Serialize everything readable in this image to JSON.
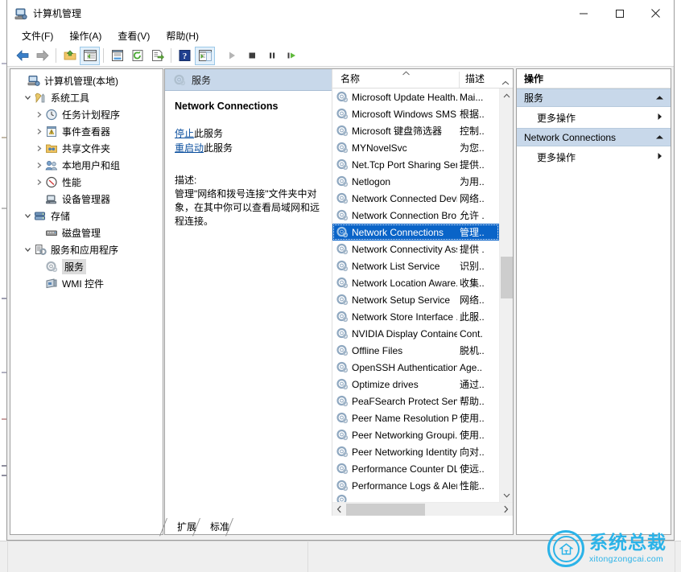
{
  "window": {
    "title": "计算机管理",
    "title_icon": "computer-management-icon",
    "buttons": {
      "minimize": "—",
      "maximize": "▢",
      "close": "✕"
    }
  },
  "menubar": {
    "items": [
      {
        "label": "文件(F)",
        "name": "menu-file"
      },
      {
        "label": "操作(A)",
        "name": "menu-action"
      },
      {
        "label": "查看(V)",
        "name": "menu-view"
      },
      {
        "label": "帮助(H)",
        "name": "menu-help"
      }
    ]
  },
  "toolbar": {
    "buttons": [
      {
        "name": "back-icon",
        "title": "后退"
      },
      {
        "name": "forward-icon",
        "title": "前进"
      },
      {
        "name": "up-folder-icon",
        "title": "上移一级"
      },
      {
        "name": "show-hide-tree-icon",
        "title": "显示/隐藏控制台树"
      },
      {
        "name": "properties-icon",
        "title": "属性"
      },
      {
        "name": "refresh-icon",
        "title": "刷新"
      },
      {
        "name": "export-list-icon",
        "title": "导出列表"
      },
      {
        "name": "help-icon",
        "title": "帮助"
      },
      {
        "name": "show-action-pane-icon",
        "title": "显示/隐藏操作窗格"
      },
      {
        "name": "start-service-icon",
        "title": "启动服务"
      },
      {
        "name": "stop-service-icon",
        "title": "停止服务"
      },
      {
        "name": "pause-service-icon",
        "title": "暂停服务"
      },
      {
        "name": "restart-service-icon",
        "title": "重启服务"
      }
    ]
  },
  "tree": {
    "nodes": [
      {
        "label": "计算机管理(本地)",
        "depth": 0,
        "twisty": "",
        "icon": "computer-icon",
        "selected": false
      },
      {
        "label": "系统工具",
        "depth": 1,
        "twisty": "v",
        "icon": "tools-icon",
        "selected": false
      },
      {
        "label": "任务计划程序",
        "depth": 2,
        "twisty": ">",
        "icon": "clock-icon",
        "selected": false
      },
      {
        "label": "事件查看器",
        "depth": 2,
        "twisty": ">",
        "icon": "event-viewer-icon",
        "selected": false
      },
      {
        "label": "共享文件夹",
        "depth": 2,
        "twisty": ">",
        "icon": "shared-folder-icon",
        "selected": false
      },
      {
        "label": "本地用户和组",
        "depth": 2,
        "twisty": ">",
        "icon": "users-icon",
        "selected": false
      },
      {
        "label": "性能",
        "depth": 2,
        "twisty": ">",
        "icon": "performance-icon",
        "selected": false
      },
      {
        "label": "设备管理器",
        "depth": 2,
        "twisty": "",
        "icon": "device-manager-icon",
        "selected": false
      },
      {
        "label": "存储",
        "depth": 1,
        "twisty": "v",
        "icon": "storage-icon",
        "selected": false
      },
      {
        "label": "磁盘管理",
        "depth": 2,
        "twisty": "",
        "icon": "disk-management-icon",
        "selected": false
      },
      {
        "label": "服务和应用程序",
        "depth": 1,
        "twisty": "v",
        "icon": "services-apps-icon",
        "selected": false
      },
      {
        "label": "服务",
        "depth": 2,
        "twisty": "",
        "icon": "gear-icon",
        "selected": true
      },
      {
        "label": "WMI 控件",
        "depth": 2,
        "twisty": "",
        "icon": "wmi-control-icon",
        "selected": false
      }
    ]
  },
  "detail": {
    "header": "服务",
    "header_icon": "gear-icon",
    "service_title": "Network Connections",
    "links": [
      {
        "link": "停止",
        "suffix": "此服务"
      },
      {
        "link": "重启动",
        "suffix": "此服务"
      }
    ],
    "description_label": "描述:",
    "description": "管理\"网络和拨号连接\"文件夹中对象，在其中你可以查看局域网和远程连接。"
  },
  "list": {
    "columns": [
      {
        "label": "名称",
        "name": "column-name",
        "sort": "asc"
      },
      {
        "label": "描述",
        "name": "column-description"
      }
    ],
    "rows": [
      {
        "name": "Microsoft Update Health...",
        "desc": "Mai...",
        "selected": false
      },
      {
        "name": "Microsoft Windows SMS ...",
        "desc": "根据..",
        "selected": false
      },
      {
        "name": "Microsoft 键盘筛选器",
        "desc": "控制..",
        "selected": false
      },
      {
        "name": "MYNovelSvc",
        "desc": "为您..",
        "selected": false
      },
      {
        "name": "Net.Tcp Port Sharing Ser...",
        "desc": "提供..",
        "selected": false
      },
      {
        "name": "Netlogon",
        "desc": "为用..",
        "selected": false
      },
      {
        "name": "Network Connected Devi...",
        "desc": "网络..",
        "selected": false
      },
      {
        "name": "Network Connection Bro...",
        "desc": "允许 .",
        "selected": false
      },
      {
        "name": "Network Connections",
        "desc": "管理..",
        "selected": true
      },
      {
        "name": "Network Connectivity Ass...",
        "desc": "提供 .",
        "selected": false
      },
      {
        "name": "Network List Service",
        "desc": "识别..",
        "selected": false
      },
      {
        "name": "Network Location Aware...",
        "desc": "收集..",
        "selected": false
      },
      {
        "name": "Network Setup Service",
        "desc": "网络..",
        "selected": false
      },
      {
        "name": "Network Store Interface ...",
        "desc": "此服..",
        "selected": false
      },
      {
        "name": "NVIDIA Display Containe...",
        "desc": "Cont.",
        "selected": false
      },
      {
        "name": "Offline Files",
        "desc": "脱机..",
        "selected": false
      },
      {
        "name": "OpenSSH Authentication ...",
        "desc": "Age..",
        "selected": false
      },
      {
        "name": "Optimize drives",
        "desc": "通过..",
        "selected": false
      },
      {
        "name": "PeaFSearch Protect Service",
        "desc": "帮助..",
        "selected": false
      },
      {
        "name": "Peer Name Resolution Pr...",
        "desc": "使用..",
        "selected": false
      },
      {
        "name": "Peer Networking Groupi...",
        "desc": "使用..",
        "selected": false
      },
      {
        "name": "Peer Networking Identity...",
        "desc": "向对..",
        "selected": false
      },
      {
        "name": "Performance Counter DL...",
        "desc": "使远..",
        "selected": false
      },
      {
        "name": "Performance Logs & Aler...",
        "desc": "性能..",
        "selected": false
      }
    ],
    "scroll": {
      "up_arrow": "⌃",
      "down_arrow": "⌄",
      "left_arrow": "❮",
      "right_arrow": "❯"
    }
  },
  "tabs": [
    {
      "label": "扩展",
      "name": "tab-extended",
      "active": false
    },
    {
      "label": "标准",
      "name": "tab-standard",
      "active": true
    }
  ],
  "actions": {
    "title": "操作",
    "groups": [
      {
        "label": "服务",
        "collapse_glyph": "▲",
        "items": [
          {
            "label": "更多操作",
            "chevron": "▶"
          }
        ]
      },
      {
        "label": "Network Connections",
        "collapse_glyph": "▲",
        "items": [
          {
            "label": "更多操作",
            "chevron": "▶"
          }
        ]
      }
    ]
  },
  "watermark": {
    "cn": "系统总裁",
    "en": "xitongzongcai.com",
    "color": "#2bb3e8"
  },
  "colors": {
    "selection_blue": "#0a64c8",
    "header_blue": "#c8d8ea",
    "link_blue": "#0b4f9e",
    "window_bg": "#f0f0f0"
  }
}
